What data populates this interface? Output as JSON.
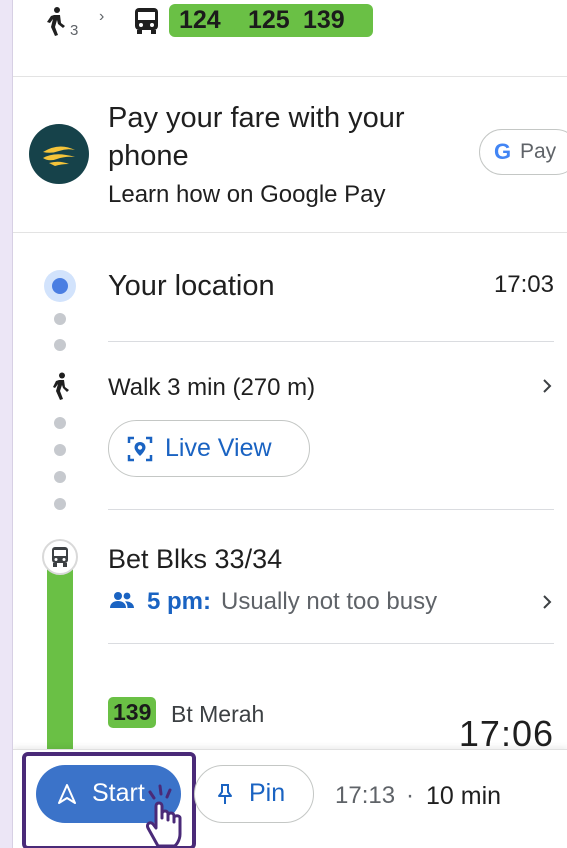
{
  "summary": {
    "walk_minutes": "3",
    "routes": [
      "124",
      "125",
      "139"
    ]
  },
  "pay": {
    "title": "Pay your fare with your phone",
    "subtitle": "Learn how on Google Pay",
    "gpay_g": "G",
    "gpay_label": "Pay"
  },
  "timeline": {
    "origin": {
      "label": "Your location",
      "time": "17:03"
    },
    "walk": {
      "text": "Walk 3 min (270 m)",
      "live_view_label": "Live View"
    },
    "stop": {
      "name": "Bet Blks 33/34",
      "busy_time": "5 pm:",
      "busy_text": "Usually not too busy",
      "route_number": "139",
      "route_destination": "Bt Merah",
      "departure_time": "17:06"
    }
  },
  "bottom_bar": {
    "start_label": "Start",
    "pin_label": "Pin",
    "arrival_time": "17:13",
    "separator": "·",
    "duration": "10 min"
  },
  "colors": {
    "route_green": "#6ac045",
    "accent_blue": "#1a63c2",
    "start_button": "#3b73c9",
    "highlight_border": "#4a2a78"
  }
}
